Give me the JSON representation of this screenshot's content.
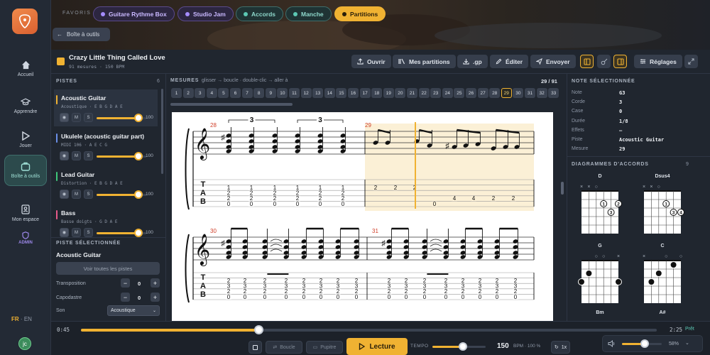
{
  "nav": {
    "items": [
      {
        "label": "Accueil",
        "icon": "home-icon"
      },
      {
        "label": "Apprendre",
        "icon": "graduation-cap-icon"
      },
      {
        "label": "Jouer",
        "icon": "play-icon"
      },
      {
        "label": "Boîte à outils",
        "icon": "toolbox-icon"
      },
      {
        "label": "Mon espace",
        "icon": "profile-card-icon"
      }
    ],
    "admin": "ADMIN",
    "lang_fr": "FR",
    "lang_sep": "·",
    "lang_en": "EN",
    "avatar": "jc"
  },
  "favorites": {
    "label": "FAVORIS",
    "chips": [
      "Guitare Rythme Box",
      "Studio Jam",
      "Accords",
      "Manche",
      "Partitions"
    ]
  },
  "back_button": "Boîte à outils",
  "song": {
    "title": "Crazy Little Thing Called Love",
    "meta": "91 mesures · 150 BPM"
  },
  "toolbar": {
    "open": "Ouvrir",
    "my_scores": "Mes partitions",
    "gp": ".gp",
    "edit": "Éditer",
    "send": "Envoyer",
    "settings": "Réglages"
  },
  "tracks": {
    "header": "PISTES",
    "count": "6",
    "items": [
      {
        "name": "Acoustic Guitar",
        "sub": "Acoustique · E B G D A E",
        "color": "#f0b232",
        "vol": "100"
      },
      {
        "name": "Ukulele (acoustic guitar part)",
        "sub": "MIDI 106 · A E C G",
        "color": "#6b8fe8",
        "vol": "100"
      },
      {
        "name": "Lead Guitar",
        "sub": "Distortion · E B G D A E",
        "color": "#3ec77a",
        "vol": "100"
      },
      {
        "name": "Bass",
        "sub": "Basse doigts · G D A E",
        "color": "#e85a8a",
        "vol": "100"
      }
    ],
    "btn_m": "M",
    "btn_s": "S"
  },
  "selected_track": {
    "header": "PISTE SÉLECTIONNÉE",
    "name": "Acoustic Guitar",
    "show_all": "Voir toutes les pistes",
    "transposition_label": "Transposition",
    "transposition": "0",
    "capo_label": "Capodastre",
    "capo": "0",
    "sound_label": "Son",
    "sound": "Acoustique"
  },
  "measures": {
    "header": "MESURES",
    "hint": "glisser → boucle · double-clic → aller à",
    "position": "29 / 91",
    "numbers": [
      "1",
      "2",
      "3",
      "4",
      "5",
      "6",
      "7",
      "8",
      "9",
      "10",
      "11",
      "12",
      "13",
      "14",
      "15",
      "16",
      "17",
      "18",
      "19",
      "20",
      "21",
      "22",
      "23",
      "24",
      "25",
      "26",
      "27",
      "28",
      "29",
      "30",
      "31",
      "32",
      "33"
    ],
    "current": "29"
  },
  "score": {
    "measure_numbers": [
      "28",
      "29",
      "30",
      "31"
    ],
    "triplet": "3",
    "tab": [
      "T",
      "A",
      "B"
    ],
    "m28_tab": [
      "1",
      "2",
      "2",
      "0"
    ],
    "m29_tab": [
      "2",
      "2",
      "2",
      "0",
      "4",
      "4",
      "2",
      "2"
    ],
    "m30_tab": [
      "2",
      "3",
      "2",
      "0"
    ]
  },
  "note_panel": {
    "header": "NOTE SÉLECTIONNÉE",
    "rows": [
      {
        "k": "Note",
        "v": "G3"
      },
      {
        "k": "Corde",
        "v": "3"
      },
      {
        "k": "Case",
        "v": "0"
      },
      {
        "k": "Durée",
        "v": "1/8"
      },
      {
        "k": "Effets",
        "v": "—"
      },
      {
        "k": "Piste",
        "v": "Acoustic Guitar"
      },
      {
        "k": "Mesure",
        "v": "29"
      }
    ]
  },
  "chord_panel": {
    "header": "DIAGRAMMES D'ACCORDS",
    "count": "9",
    "chords": [
      "D",
      "Dsus4",
      "G",
      "C",
      "Bm",
      "A#"
    ]
  },
  "transport": {
    "time_current": "0:45",
    "time_total": "2:25",
    "ready": "Prêt",
    "progress": 0.31,
    "loop": "Boucle",
    "stand": "Pupitre",
    "play": "Lecture",
    "tempo_label": "TEMPO",
    "bpm": "150",
    "bpm_unit": "BPM · 100 %",
    "speed": "1x",
    "volume": "58%"
  },
  "colors": {
    "accent": "#f0b232",
    "teal": "#3f6e6b",
    "purple": "#5b4a8c"
  }
}
